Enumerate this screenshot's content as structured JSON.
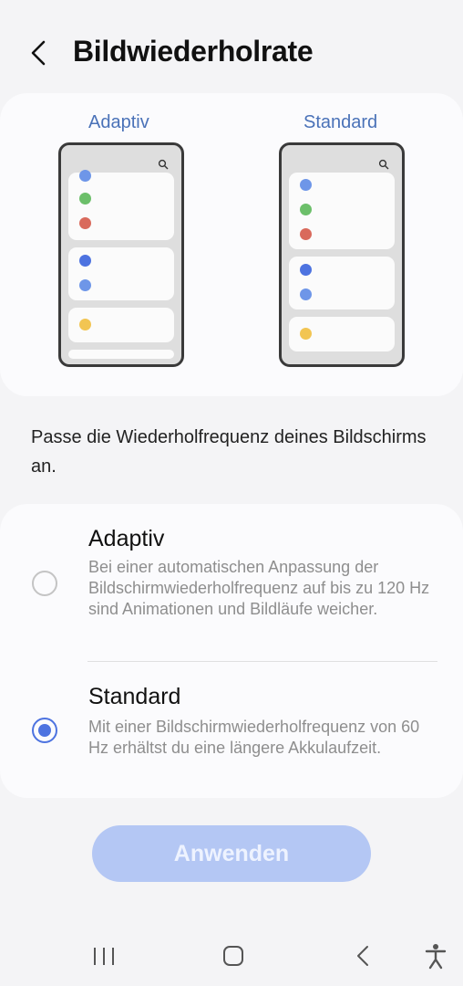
{
  "header": {
    "title": "Bildwiederholrate",
    "back_icon": "chevron-left-icon"
  },
  "preview": {
    "adaptive_label": "Adaptiv",
    "standard_label": "Standard"
  },
  "description": "Passe die Wiederholfrequenz deines Bildschirms an.",
  "options": [
    {
      "title": "Adaptiv",
      "description": "Bei einer automatischen Anpassung der Bildschirmwiederholfrequenz auf bis zu 120 Hz sind Animationen und Bildläufe weicher.",
      "selected": false
    },
    {
      "title": "Standard",
      "description": "Mit einer Bildschirmwiederholfrequenz von 60 Hz erhältst du eine längere Akkulaufzeit.",
      "selected": true
    }
  ],
  "apply_button": "Anwenden",
  "navbar": [
    "recent-apps-icon",
    "home-icon",
    "back-icon",
    "accessibility-icon"
  ],
  "colors": {
    "accent": "#4d73e0",
    "label_blue": "#4a72b8",
    "button_disabled": "#b4c7f4",
    "dot_green": "#6cbf6a",
    "dot_red": "#d96a5c",
    "dot_blue": "#4d73e0",
    "dot_lightblue": "#6e96e8",
    "dot_yellow": "#f2c552"
  }
}
